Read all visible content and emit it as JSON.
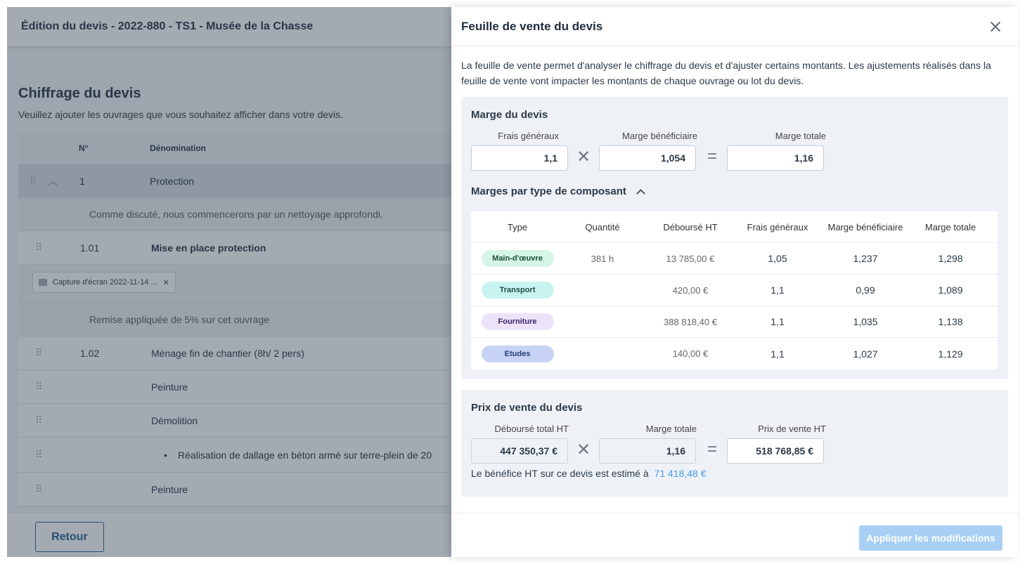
{
  "background": {
    "header_title": "Édition du devis - 2022-880 - TS1 - Musée de la Chasse",
    "section_title": "Chiffrage du devis",
    "section_subtitle": "Veuillez ajouter les ouvrages que vous souhaitez afficher dans votre devis.",
    "table_headers": {
      "number": "N°",
      "denomination": "Dénomination"
    },
    "rows": {
      "lot_number": "1",
      "lot_label": "Protection",
      "lot_note": "Comme discuté, nous commencerons par un nettoyage approfondi.",
      "item1_number": "1.01",
      "item1_label": "Mise en place protection",
      "attachment_name": "Capture d'écran 2022-11-14 ...",
      "item1_note": "Remise appliquée de 5% sur cet ouvrage",
      "item2_number": "1.02",
      "item2_label": "Ménage fin de chantier (8h/ 2 pers)",
      "text_peinture_1": "Peinture",
      "text_demolition": "Démolition",
      "text_bullet": "Réalisation de dallage en béton armé sur terre-plein de 20",
      "text_peinture_2": "Peinture"
    },
    "back_button": "Retour"
  },
  "drawer": {
    "title": "Feuille de vente du devis",
    "intro": "La feuille de vente permet d'analyser le chiffrage du devis et d'ajuster certains montants. Les ajustements réalisés dans la feuille de vente vont impacter les montants de chaque ouvrage ou lot du devis.",
    "marge": {
      "title": "Marge du devis",
      "frais_label": "Frais généraux",
      "frais_value": "1,1",
      "benef_label": "Marge bénéficiaire",
      "benef_value": "1,054",
      "totale_label": "Marge totale",
      "totale_value": "1,16",
      "times_symbol": "✕",
      "equals_symbol": "="
    },
    "composants": {
      "title": "Marges par type de composant",
      "expanded": true,
      "headers": {
        "type": "Type",
        "quantite": "Quantité",
        "debourse": "Déboursé HT",
        "frais": "Frais généraux",
        "benef": "Marge bénéficiaire",
        "totale": "Marge totale"
      },
      "rows": [
        {
          "type": "Main-d'œuvre",
          "quantite": "381 h",
          "debourse": "13 785,00 €",
          "frais": "1,05",
          "benef": "1,237",
          "totale": "1,298"
        },
        {
          "type": "Transport",
          "quantite": "",
          "debourse": "420,00 €",
          "frais": "1,1",
          "benef": "0,99",
          "totale": "1,089"
        },
        {
          "type": "Fourniture",
          "quantite": "",
          "debourse": "388 818,40 €",
          "frais": "1,1",
          "benef": "1,035",
          "totale": "1,138"
        },
        {
          "type": "Etudes",
          "quantite": "",
          "debourse": "140,00 €",
          "frais": "1,1",
          "benef": "1,027",
          "totale": "1,129"
        }
      ],
      "pill_colors": {
        "main_doeuvre": {
          "bg": "#d5f5e6",
          "fg": "#1d4d36"
        },
        "transport": {
          "bg": "#c9f3ef",
          "fg": "#1b4c48"
        },
        "fourniture": {
          "bg": "#ece3fb",
          "fg": "#3a2466"
        },
        "etudes": {
          "bg": "#c6d3f5",
          "fg": "#263a78"
        }
      }
    },
    "prix": {
      "title": "Prix de vente du devis",
      "debourse_label": "Déboursé total HT",
      "debourse_value": "447 350,37 €",
      "marge_label": "Marge totale",
      "marge_value": "1,16",
      "prix_label": "Prix de vente HT",
      "prix_value": "518 768,85 €",
      "benefice_text": "Le bénéfice HT sur ce devis est estimé à",
      "benefice_value": "71 418,48 €"
    },
    "apply_button": "Appliquer les modifications"
  },
  "colors": {
    "accent": "#4a9be8",
    "apply_disabled": "#a9d0f4",
    "panel_bg": "#eef2f7",
    "overlay": "#324255"
  }
}
